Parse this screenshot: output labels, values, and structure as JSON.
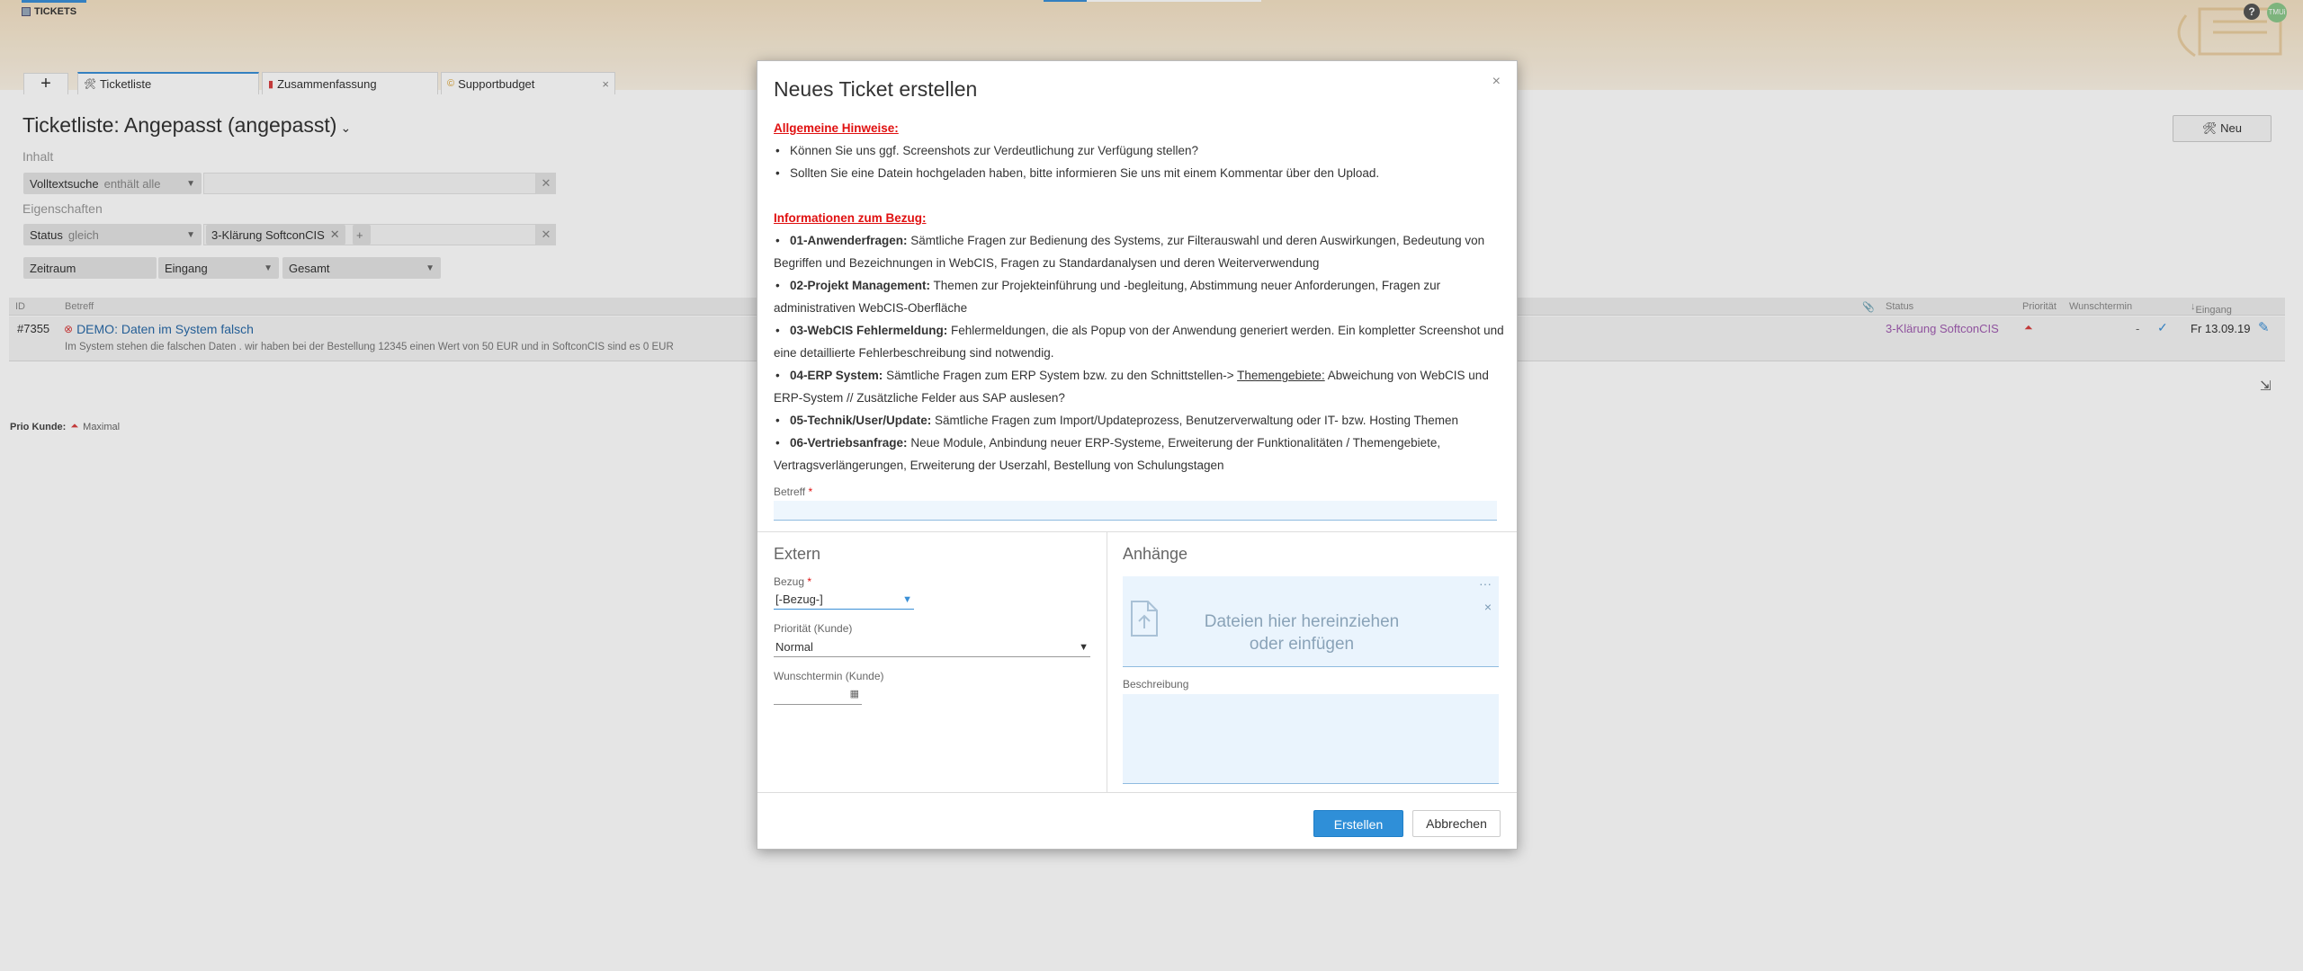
{
  "app": {
    "title": "TICKETS",
    "user_initials": "TMUi",
    "help_label": "?"
  },
  "tabs": [
    {
      "label": "Ticketliste",
      "active": true
    },
    {
      "label": "Zusammenfassung",
      "active": false
    },
    {
      "label": "Supportbudget",
      "active": false,
      "close": "×"
    }
  ],
  "tab_add_label": "+",
  "page": {
    "title": "Ticketliste: Angepasst (angepasst)",
    "new_button": "Neu"
  },
  "filters": {
    "inhalt_label": "Inhalt",
    "fulltext_label": "Volltextsuche",
    "fulltext_op": "enthält alle",
    "eigenschaften_label": "Eigenschaften",
    "status_label": "Status",
    "status_op": "gleich",
    "status_chip": "3-Klärung SoftconCIS",
    "chip_add": "+",
    "zeitraum_label": "Zeitraum",
    "zeitraum_op": "Eingang",
    "zeitraum_value": "Gesamt"
  },
  "table": {
    "columns": [
      "ID",
      "Betreff",
      "Status",
      "Priorität",
      "Wunschtermin",
      "Eingang"
    ],
    "rows": [
      {
        "id": "#7355",
        "subject": "DEMO: Daten im System falsch",
        "description": "Im System stehen die falschen Daten . wir haben bei der Bestellung 12345 einen Wert von 50 EUR und in SoftconCIS sind es 0 EUR",
        "status": "3-Klärung SoftconCIS",
        "wunschtermin": "-",
        "eingang": "Fr 13.09.19"
      }
    ]
  },
  "prio_legend": {
    "label": "Prio Kunde:",
    "value": "Maximal"
  },
  "modal": {
    "title": "Neues Ticket erstellen",
    "close": "×",
    "general_heading": "Allgemeine Hinweise:",
    "general_items": [
      "Können Sie uns ggf. Screenshots zur Verdeutlichung zur Verfügung stellen?",
      "Sollten Sie eine Datein hochgeladen haben, bitte informieren Sie uns mit einem Kommentar über den Upload."
    ],
    "bezug_heading": "Informationen zum Bezug:",
    "bezug_items": [
      {
        "bold": "01-Anwenderfragen:",
        "text": " Sämtliche Fragen zur Bedienung des Systems, zur Filterauswahl und deren Auswirkungen, Bedeutung von Begriffen und Bezeichnungen in WebCIS, Fragen zu Standardanalysen und deren Weiterverwendung"
      },
      {
        "bold": "02-Projekt Management:",
        "text": " Themen zur Projekteinführung und -begleitung, Abstimmung neuer Anforderungen, Fragen zur administrativen WebCIS-Oberfläche"
      },
      {
        "bold": "03-WebCIS Fehlermeldung:",
        "text": " Fehlermeldungen, die als Popup von der Anwendung generiert werden. Ein kompletter Screenshot und eine detaillierte Fehlerbeschreibung sind notwendig."
      },
      {
        "bold": "04-ERP System:",
        "text_pre": " Sämtliche Fragen zum ERP System bzw. zu den Schnittstellen-> ",
        "underline": "Themengebiete:",
        "text_post": " Abweichung von WebCIS und ERP-System // Zusätzliche Felder aus SAP auslesen?"
      },
      {
        "bold": "05-Technik/User/Update:",
        "text": " Sämtliche Fragen zum Import/Updateprozess, Benutzerverwaltung oder IT- bzw. Hosting Themen"
      },
      {
        "bold": "06-Vertriebsanfrage:",
        "text": " Neue Module, Anbindung neuer ERP-Systeme, Erweiterung der Funktionalitäten / Themengebiete, Vertragsverlängerungen, Erweiterung der Userzahl, Bestellung von Schulungstagen"
      }
    ],
    "betreff_label": "Betreff",
    "required_mark": "*",
    "extern_heading": "Extern",
    "bezug_label": "Bezug",
    "bezug_value": "[-Bezug-]",
    "prio_label": "Priorität (Kunde)",
    "prio_value": "Normal",
    "wunsch_label": "Wunschtermin (Kunde)",
    "anhaenge_heading": "Anhänge",
    "dropzone_text": "Dateien hier hereinziehen oder einfügen",
    "dropzone_more": "···",
    "dropzone_close": "×",
    "beschreibung_label": "Beschreibung",
    "create_button": "Erstellen",
    "cancel_button": "Abbrechen"
  },
  "colors": {
    "accent": "#2f8fd8",
    "required": "#e01010",
    "status_purple": "#a05cb0"
  }
}
